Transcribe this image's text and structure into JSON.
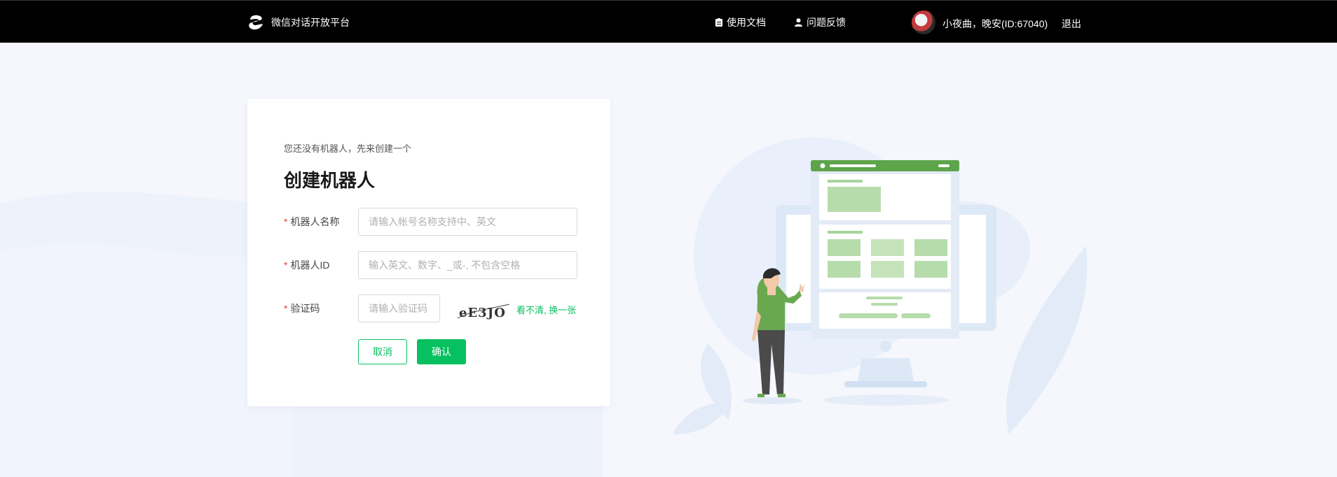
{
  "header": {
    "brand": "微信对话开放平台",
    "nav": {
      "docs": "使用文档",
      "feedback": "问题反馈"
    },
    "user": "小夜曲，晚安(ID:67040)",
    "logout": "退出"
  },
  "form": {
    "subtitle": "您还没有机器人，先来创建一个",
    "title": "创建机器人",
    "required_mark": "*",
    "name_label": "机器人名称",
    "name_placeholder": "请输入帐号名称支持中、英文",
    "id_label": "机器人ID",
    "id_placeholder": "输入英文、数字、_或-, 不包含空格",
    "captcha_label": "验证码",
    "captcha_placeholder": "请输入验证码",
    "captcha_text": "eE3JO",
    "captcha_refresh": "看不清, 换一张",
    "cancel": "取消",
    "confirm": "确认"
  },
  "colors": {
    "accent": "#07c160",
    "required": "#e64340",
    "topbar": "#000000",
    "page_bg": "#f5f7fd"
  },
  "icons": {
    "brand": "wechat-dialog-logo",
    "docs": "document-icon",
    "feedback": "user-icon"
  }
}
